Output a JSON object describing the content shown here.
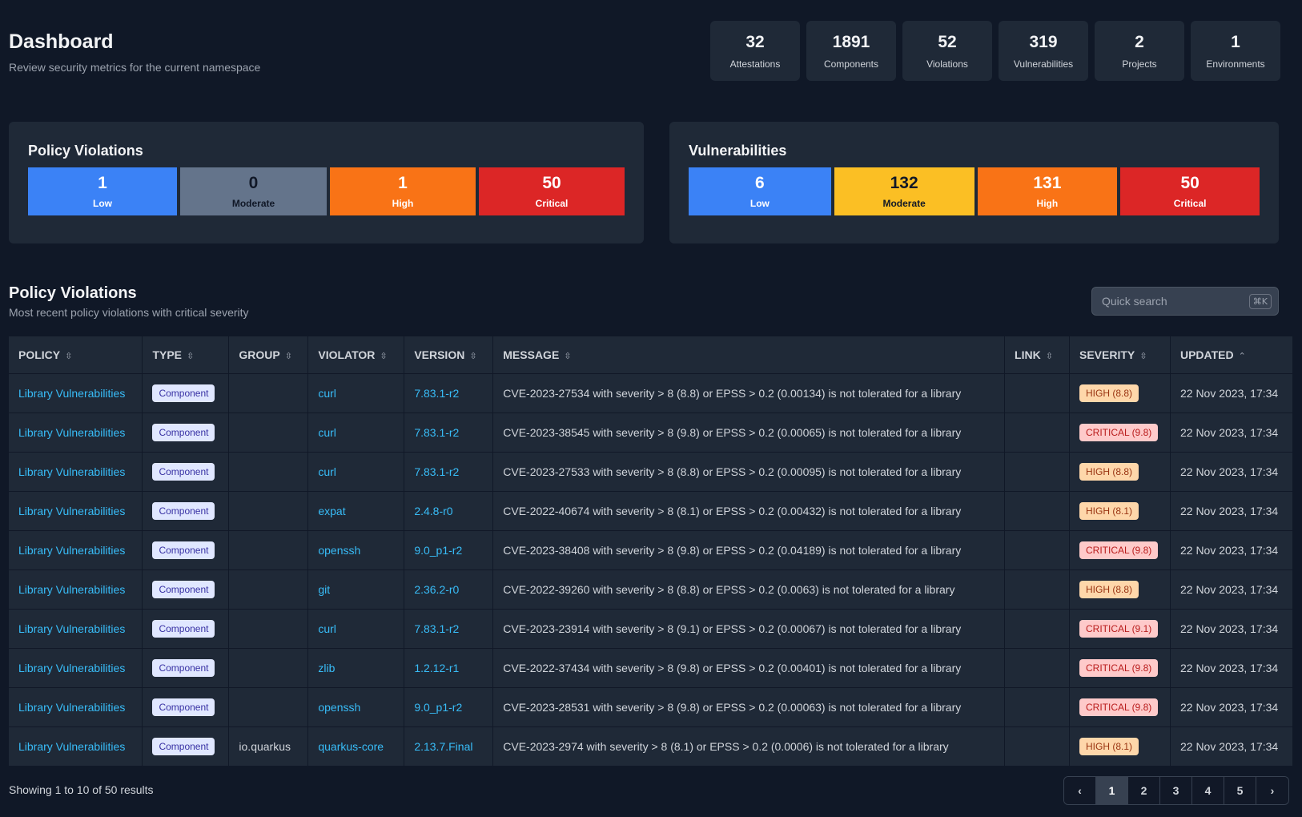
{
  "header": {
    "title": "Dashboard",
    "subtitle": "Review security metrics for the current namespace"
  },
  "stats": [
    {
      "value": "32",
      "label": "Attestations"
    },
    {
      "value": "1891",
      "label": "Components"
    },
    {
      "value": "52",
      "label": "Violations"
    },
    {
      "value": "319",
      "label": "Vulnerabilities"
    },
    {
      "value": "2",
      "label": "Projects"
    },
    {
      "value": "1",
      "label": "Environments"
    }
  ],
  "policy_card": {
    "title": "Policy Violations",
    "levels": [
      {
        "value": "1",
        "label": "Low",
        "color": "#3b82f6"
      },
      {
        "value": "0",
        "label": "Moderate",
        "color": "#64748b"
      },
      {
        "value": "1",
        "label": "High",
        "color": "#f97316"
      },
      {
        "value": "50",
        "label": "Critical",
        "color": "#dc2626"
      }
    ]
  },
  "vuln_card": {
    "title": "Vulnerabilities",
    "levels": [
      {
        "value": "6",
        "label": "Low",
        "color": "#3b82f6"
      },
      {
        "value": "132",
        "label": "Moderate",
        "color": "#fbbf24"
      },
      {
        "value": "131",
        "label": "High",
        "color": "#f97316"
      },
      {
        "value": "50",
        "label": "Critical",
        "color": "#dc2626"
      }
    ]
  },
  "section": {
    "title": "Policy Violations",
    "subtitle": "Most recent policy violations with critical severity"
  },
  "search": {
    "placeholder": "Quick search",
    "shortcut": "⌘K"
  },
  "table": {
    "columns": [
      {
        "label": "POLICY",
        "sort": "⇳"
      },
      {
        "label": "TYPE",
        "sort": "⇳"
      },
      {
        "label": "GROUP",
        "sort": "⇳"
      },
      {
        "label": "VIOLATOR",
        "sort": "⇳"
      },
      {
        "label": "VERSION",
        "sort": "⇳"
      },
      {
        "label": "MESSAGE",
        "sort": "⇳"
      },
      {
        "label": "LINK",
        "sort": "⇳"
      },
      {
        "label": "SEVERITY",
        "sort": "⇳"
      },
      {
        "label": "UPDATED",
        "sort": "⌃"
      }
    ],
    "rows": [
      {
        "policy": "Library Vulnerabilities",
        "type": "Component",
        "group": "",
        "violator": "curl",
        "version": "7.83.1-r2",
        "message": "CVE-2023-27534 with severity > 8 (8.8) or EPSS > 0.2 (0.00134) is not tolerated for a library",
        "link": "",
        "severity": "HIGH (8.8)",
        "severity_level": "high",
        "updated": "22 Nov 2023, 17:34"
      },
      {
        "policy": "Library Vulnerabilities",
        "type": "Component",
        "group": "",
        "violator": "curl",
        "version": "7.83.1-r2",
        "message": "CVE-2023-38545 with severity > 8 (9.8) or EPSS > 0.2 (0.00065) is not tolerated for a library",
        "link": "",
        "severity": "CRITICAL (9.8)",
        "severity_level": "critical",
        "updated": "22 Nov 2023, 17:34"
      },
      {
        "policy": "Library Vulnerabilities",
        "type": "Component",
        "group": "",
        "violator": "curl",
        "version": "7.83.1-r2",
        "message": "CVE-2023-27533 with severity > 8 (8.8) or EPSS > 0.2 (0.00095) is not tolerated for a library",
        "link": "",
        "severity": "HIGH (8.8)",
        "severity_level": "high",
        "updated": "22 Nov 2023, 17:34"
      },
      {
        "policy": "Library Vulnerabilities",
        "type": "Component",
        "group": "",
        "violator": "expat",
        "version": "2.4.8-r0",
        "message": "CVE-2022-40674 with severity > 8 (8.1) or EPSS > 0.2 (0.00432) is not tolerated for a library",
        "link": "",
        "severity": "HIGH (8.1)",
        "severity_level": "high",
        "updated": "22 Nov 2023, 17:34"
      },
      {
        "policy": "Library Vulnerabilities",
        "type": "Component",
        "group": "",
        "violator": "openssh",
        "version": "9.0_p1-r2",
        "message": "CVE-2023-38408 with severity > 8 (9.8) or EPSS > 0.2 (0.04189) is not tolerated for a library",
        "link": "",
        "severity": "CRITICAL (9.8)",
        "severity_level": "critical",
        "updated": "22 Nov 2023, 17:34"
      },
      {
        "policy": "Library Vulnerabilities",
        "type": "Component",
        "group": "",
        "violator": "git",
        "version": "2.36.2-r0",
        "message": "CVE-2022-39260 with severity > 8 (8.8) or EPSS > 0.2 (0.0063) is not tolerated for a library",
        "link": "",
        "severity": "HIGH (8.8)",
        "severity_level": "high",
        "updated": "22 Nov 2023, 17:34"
      },
      {
        "policy": "Library Vulnerabilities",
        "type": "Component",
        "group": "",
        "violator": "curl",
        "version": "7.83.1-r2",
        "message": "CVE-2023-23914 with severity > 8 (9.1) or EPSS > 0.2 (0.00067) is not tolerated for a library",
        "link": "",
        "severity": "CRITICAL (9.1)",
        "severity_level": "critical",
        "updated": "22 Nov 2023, 17:34"
      },
      {
        "policy": "Library Vulnerabilities",
        "type": "Component",
        "group": "",
        "violator": "zlib",
        "version": "1.2.12-r1",
        "message": "CVE-2022-37434 with severity > 8 (9.8) or EPSS > 0.2 (0.00401) is not tolerated for a library",
        "link": "",
        "severity": "CRITICAL (9.8)",
        "severity_level": "critical",
        "updated": "22 Nov 2023, 17:34"
      },
      {
        "policy": "Library Vulnerabilities",
        "type": "Component",
        "group": "",
        "violator": "openssh",
        "version": "9.0_p1-r2",
        "message": "CVE-2023-28531 with severity > 8 (9.8) or EPSS > 0.2 (0.00063) is not tolerated for a library",
        "link": "",
        "severity": "CRITICAL (9.8)",
        "severity_level": "critical",
        "updated": "22 Nov 2023, 17:34"
      },
      {
        "policy": "Library Vulnerabilities",
        "type": "Component",
        "group": "io.quarkus",
        "violator": "quarkus-core",
        "version": "2.13.7.Final",
        "message": "CVE-2023-2974 with severity > 8 (8.1) or EPSS > 0.2 (0.0006) is not tolerated for a library",
        "link": "",
        "severity": "HIGH (8.1)",
        "severity_level": "high",
        "updated": "22 Nov 2023, 17:34"
      }
    ]
  },
  "footer": {
    "results_text": "Showing 1 to 10 of 50 results",
    "prev_icon": "‹",
    "next_icon": "›",
    "pages": [
      "1",
      "2",
      "3",
      "4",
      "5"
    ],
    "current_page": "1"
  }
}
